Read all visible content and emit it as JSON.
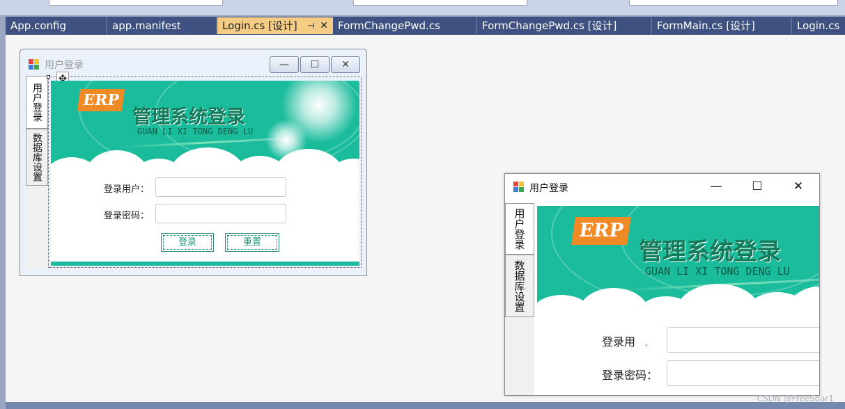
{
  "tabs": [
    {
      "label": "App.config",
      "active": false
    },
    {
      "label": "app.manifest",
      "active": false
    },
    {
      "label": "Login.cs [设计]",
      "active": true
    },
    {
      "label": "FormChangePwd.cs",
      "active": false
    },
    {
      "label": "FormChangePwd.cs [设计]",
      "active": false
    },
    {
      "label": "FormMain.cs [设计]",
      "active": false
    },
    {
      "label": "Login.cs",
      "active": false
    }
  ],
  "tab_icons": {
    "pin": "⊣",
    "close": "✕"
  },
  "form": {
    "title": "用户登录",
    "side_tabs": [
      "用户登录",
      "数据库设置"
    ],
    "banner": {
      "logo": "ERP",
      "title": "管理系统登录",
      "subtitle": "GUAN LI XI TONG DENG LU"
    },
    "user_label": "登录用户：",
    "pwd_label": "登录密码：",
    "login_button": "登录",
    "reset_button": "重置"
  },
  "runtime_form": {
    "title": "用户登录",
    "side_tabs": [
      "用户登录",
      "数据库设置"
    ],
    "user_label": "登录用",
    "user_label_tail": ".",
    "pwd_label": "登录密码："
  },
  "window_controls": {
    "minimize": "—",
    "maximize": "☐",
    "close": "✕"
  },
  "watermark": "CSDN @FreeSoar1",
  "colors": {
    "tab_bg": "#3e5181",
    "tab_active": "#f5cc84",
    "banner": "#1abc9c",
    "erp": "#f08a24"
  }
}
